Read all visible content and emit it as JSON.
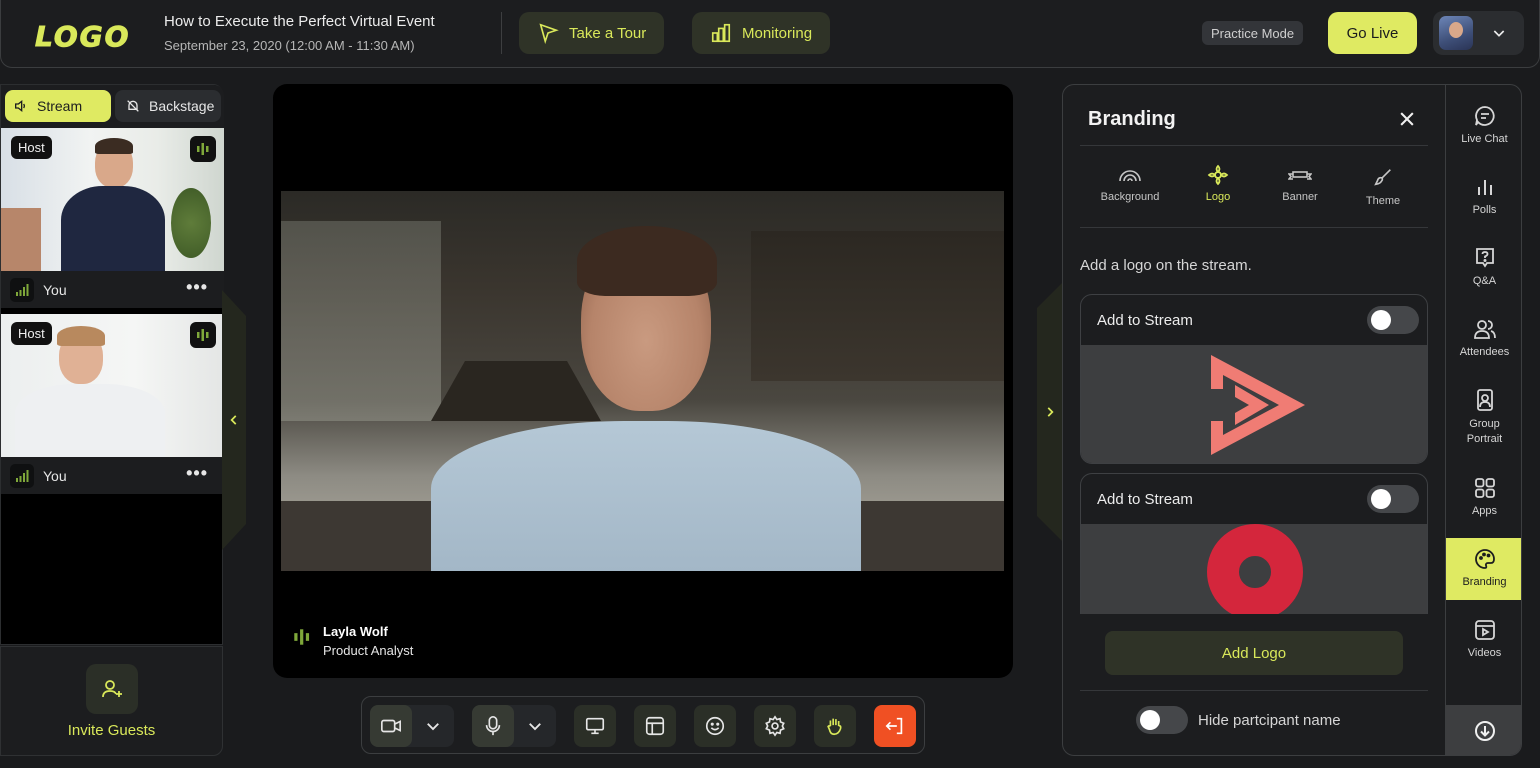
{
  "header": {
    "logo_text": "LOGO",
    "event_title": "How to Execute the Perfect Virtual Event",
    "event_date": "September 23, 2020 (12:00 AM - 11:30 AM)",
    "tour_label": "Take a Tour",
    "monitoring_label": "Monitoring",
    "practice_label": "Practice Mode",
    "golive_label": "Go Live"
  },
  "left_panel": {
    "tabs": [
      {
        "label": "Stream",
        "active": true
      },
      {
        "label": "Backstage",
        "active": false
      }
    ],
    "participants": [
      {
        "role": "Host",
        "name": "You"
      },
      {
        "role": "Host",
        "name": "You"
      }
    ],
    "invite_label": "Invite Guests"
  },
  "stage": {
    "speaker_name": "Layla Wolf",
    "speaker_role": "Product Analyst"
  },
  "controls": [
    {
      "icon": "camera-icon",
      "has_menu": true
    },
    {
      "icon": "microphone-icon",
      "has_menu": true
    },
    {
      "icon": "screen-share-icon"
    },
    {
      "icon": "layout-icon"
    },
    {
      "icon": "emoji-icon"
    },
    {
      "icon": "settings-gear-icon"
    },
    {
      "icon": "raise-hand-icon"
    },
    {
      "icon": "leave-icon",
      "color": "#f05023"
    }
  ],
  "branding": {
    "title": "Branding",
    "tabs": [
      {
        "label": "Background",
        "icon": "rainbow-icon",
        "active": false
      },
      {
        "label": "Logo",
        "icon": "flower-icon",
        "active": true
      },
      {
        "label": "Banner",
        "icon": "banner-icon",
        "active": false
      },
      {
        "label": "Theme",
        "icon": "brush-icon",
        "active": false
      }
    ],
    "description": "Add a logo on the stream.",
    "cards": [
      {
        "label": "Add to Stream",
        "enabled": false,
        "logo": "play-triangle-logo",
        "logo_color": "#f07c74"
      },
      {
        "label": "Add to Stream",
        "enabled": false,
        "logo": "ring-logo",
        "logo_color": "#d4263c"
      }
    ],
    "add_logo_label": "Add Logo",
    "hide_participant_label": "Hide partcipant name",
    "hide_participant_enabled": false
  },
  "rail": {
    "items": [
      {
        "label": "Live Chat",
        "icon": "chat-bubble-icon"
      },
      {
        "label": "Polls",
        "icon": "bar-chart-icon"
      },
      {
        "label": "Q&A",
        "icon": "question-icon"
      },
      {
        "label": "Attendees",
        "icon": "people-icon"
      },
      {
        "label": "Group Portrait",
        "icon": "portrait-icon"
      },
      {
        "label": "Apps",
        "icon": "apps-grid-icon"
      },
      {
        "label": "Branding",
        "icon": "palette-icon",
        "active": true
      },
      {
        "label": "Videos",
        "icon": "video-play-icon"
      }
    ]
  },
  "colors": {
    "accent": "#dfea62",
    "background": "#1a1b1d",
    "panel": "#1c1d1f",
    "danger": "#f05023"
  }
}
